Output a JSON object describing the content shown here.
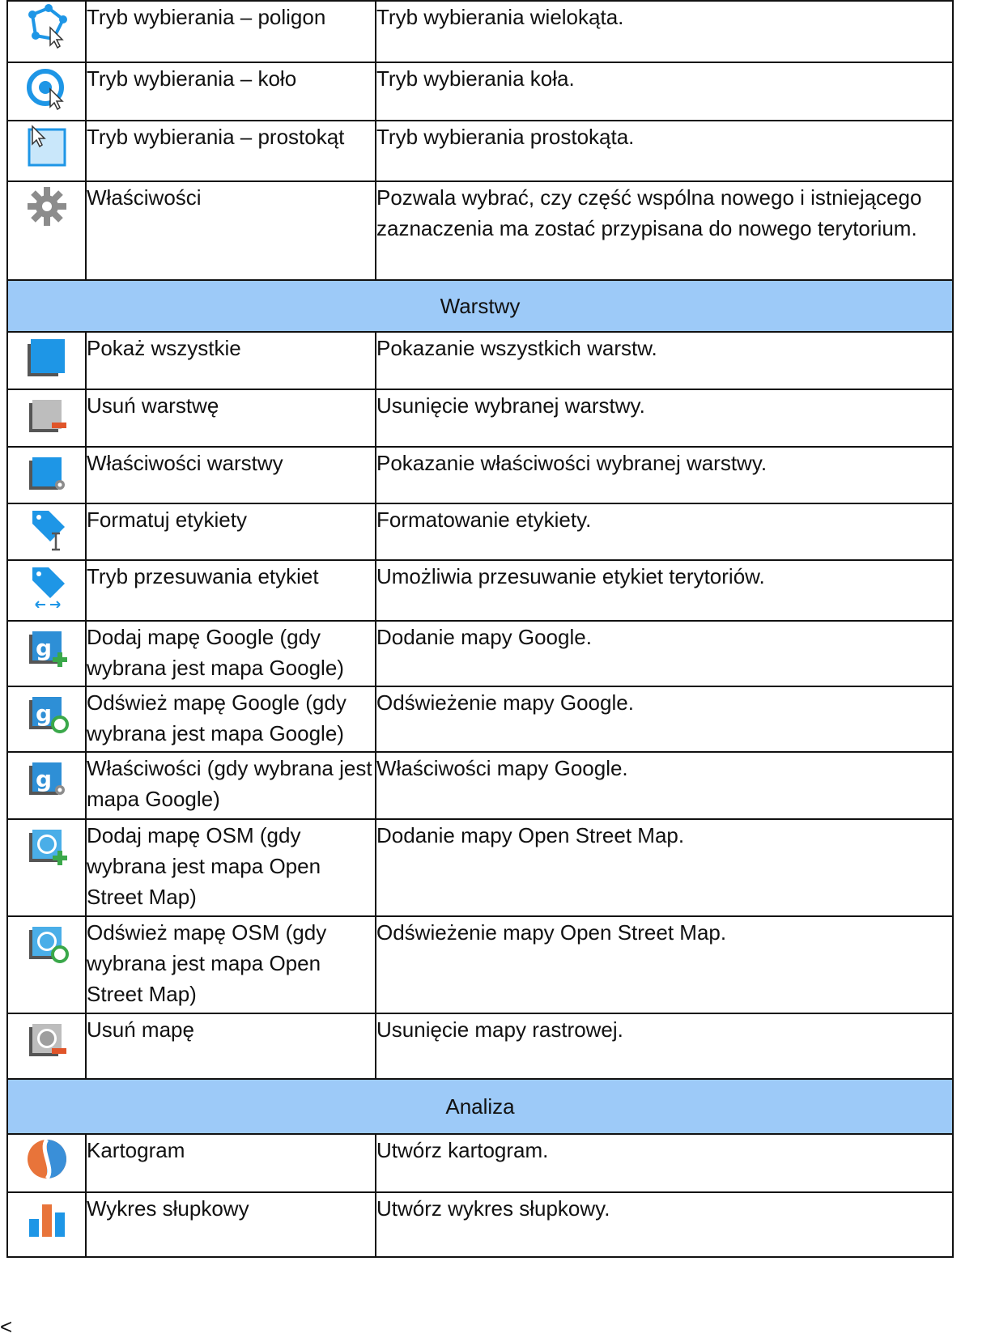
{
  "rows": [
    {
      "kind": "item",
      "icon": "polygon-select-icon",
      "name": "Tryb wybierania – poligon",
      "desc": "Tryb wybierania wielokąta.",
      "h": 76
    },
    {
      "kind": "item",
      "icon": "circle-select-icon",
      "name": "Tryb wybierania – koło",
      "desc": "Tryb wybierania koła.",
      "h": 72
    },
    {
      "kind": "item",
      "icon": "rectangle-select-icon",
      "name": "Tryb wybierania – prostokąt",
      "desc": "Tryb wybierania prostokąta.",
      "h": 75
    },
    {
      "kind": "item",
      "icon": "gear-icon",
      "name": "Właściwości",
      "desc": "Pozwala wybrać, czy część wspólna nowego i istniejącego zaznaczenia ma zostać przypisana do nowego terytorium.",
      "h": 122
    },
    {
      "kind": "section",
      "title": "Warstwy",
      "h": 64
    },
    {
      "kind": "item",
      "icon": "show-all-layers-icon",
      "name": "Pokaż wszystkie",
      "desc": "Pokazanie wszystkich warstw.",
      "h": 71
    },
    {
      "kind": "item",
      "icon": "remove-layer-icon",
      "name": "Usuń warstwę",
      "desc": "Usunięcie wybranej warstwy.",
      "h": 71
    },
    {
      "kind": "item",
      "icon": "layer-properties-icon",
      "name": "Właściwości warstwy",
      "desc": "Pokazanie właściwości wybranej warstwy.",
      "h": 70
    },
    {
      "kind": "item",
      "icon": "format-labels-icon",
      "name": "Formatuj etykiety",
      "desc": "Formatowanie etykiety.",
      "h": 68
    },
    {
      "kind": "item",
      "icon": "move-labels-icon",
      "name": "Tryb przesuwania etykiet",
      "desc": "Umożliwia przesuwanie etykiet terytoriów.",
      "h": 75
    },
    {
      "kind": "item",
      "icon": "add-google-map-icon",
      "name": "Dodaj mapę Google (gdy wybrana jest mapa Google)",
      "desc": "Dodanie mapy Google.",
      "h": 81
    },
    {
      "kind": "item",
      "icon": "refresh-google-map-icon",
      "name": "Odśwież mapę Google (gdy wybrana jest mapa Google)",
      "desc": "Odświeżenie mapy Google.",
      "h": 81
    },
    {
      "kind": "item",
      "icon": "google-map-properties-icon",
      "name": "Właściwości (gdy wybrana jest mapa Google)",
      "desc": "Właściwości mapy Google.",
      "h": 83
    },
    {
      "kind": "item",
      "icon": "add-osm-map-icon",
      "name": "Dodaj mapę OSM (gdy wybrana jest mapa Open Street Map)",
      "desc": "Dodanie mapy Open Street Map.",
      "h": 120
    },
    {
      "kind": "item",
      "icon": "refresh-osm-map-icon",
      "name": "Odśwież mapę OSM (gdy wybrana jest mapa Open Street Map)",
      "desc": "Odświeżenie mapy Open Street Map.",
      "h": 120
    },
    {
      "kind": "item",
      "icon": "remove-map-icon",
      "name": "Usuń mapę",
      "desc": "Usunięcie mapy rastrowej.",
      "h": 81
    },
    {
      "kind": "section",
      "title": "Analiza",
      "h": 68
    },
    {
      "kind": "item",
      "icon": "cartogram-icon",
      "name": "Kartogram",
      "desc": "Utwórz kartogram.",
      "h": 72
    },
    {
      "kind": "item",
      "icon": "bar-chart-icon",
      "name": "Wykres słupkowy",
      "desc": "Utwórz wykres słupkowy.",
      "h": 80
    }
  ],
  "stray_char": "<",
  "colors": {
    "section_bg": "#9dcaf8",
    "icon_blue": "#1e96e6",
    "icon_gray": "#8c8c8c",
    "icon_red": "#e0552a",
    "icon_green": "#3aa84a"
  }
}
